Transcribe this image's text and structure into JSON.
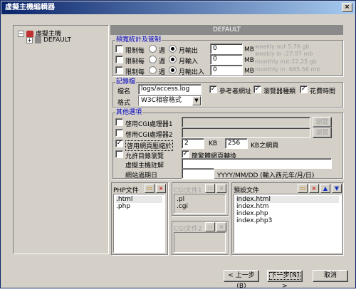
{
  "window": {
    "title": "虛擬主機編輯器",
    "close": "×"
  },
  "tree": {
    "root": "虛擬主機",
    "child": "DEFAULT",
    "expander_root": "−",
    "expander_child": "+"
  },
  "header": "DEFAULT",
  "bandwidth": {
    "label": "頻寬統計及管制",
    "rows": [
      {
        "limit": "限制每",
        "week": "週",
        "month": "月輸出",
        "value": "0",
        "unit": "MB",
        "stat": "weekly out 5.76 gb"
      },
      {
        "limit": "限制每",
        "week": "週",
        "month": "月輸入",
        "value": "0",
        "unit": "MB",
        "stat": "weekly in :27.97 mb"
      },
      {
        "limit": "限制每",
        "week": "週",
        "month": "月輸出入",
        "value": "0",
        "unit": "MB",
        "stat": "monthly out:22.25 gb"
      }
    ],
    "stat4": "monthly in :685.56 mb"
  },
  "log": {
    "label": "記錄檔",
    "file_label": "檔名",
    "file_value": "logs/access.log",
    "format_label": "格式",
    "format_value": "W3C相容格式",
    "opt1": "參考者網址",
    "opt2": "瀏覽器種類",
    "opt3": "花費時間"
  },
  "other": {
    "label": "其他選項",
    "cgi1": "啓用CGI處理器1",
    "cgi2": "啓用CGI處理器2",
    "browse": "瀏覽",
    "compress": "啓用網頁壓縮於",
    "compress_val1": "2",
    "kb": "KB",
    "compress_val2": "256",
    "kb_page": "KB之網頁",
    "dirbrowse": "允許目錄瀏覽",
    "convert": "簡繁體網頁轉換",
    "reg_label": "虛擬主機註解",
    "expire_label": "網站過期日",
    "expire_hint": "YYYY/MM/DD (輸入西元年/月/日)"
  },
  "php": {
    "title": "PHP文件",
    "items": [
      ".html",
      ".php"
    ]
  },
  "cgi1": {
    "title": "CGI文件1",
    "items": [
      ".pl",
      ".cgi"
    ]
  },
  "cgi2": {
    "title": "CGI文件2",
    "items": []
  },
  "default": {
    "title": "預設文件",
    "items": [
      "index.html",
      "index.htm",
      "index.php",
      "index.php3"
    ]
  },
  "buttons": {
    "prev": "< 上一步(B)",
    "next": "下一步(N) >",
    "cancel": "取消"
  }
}
